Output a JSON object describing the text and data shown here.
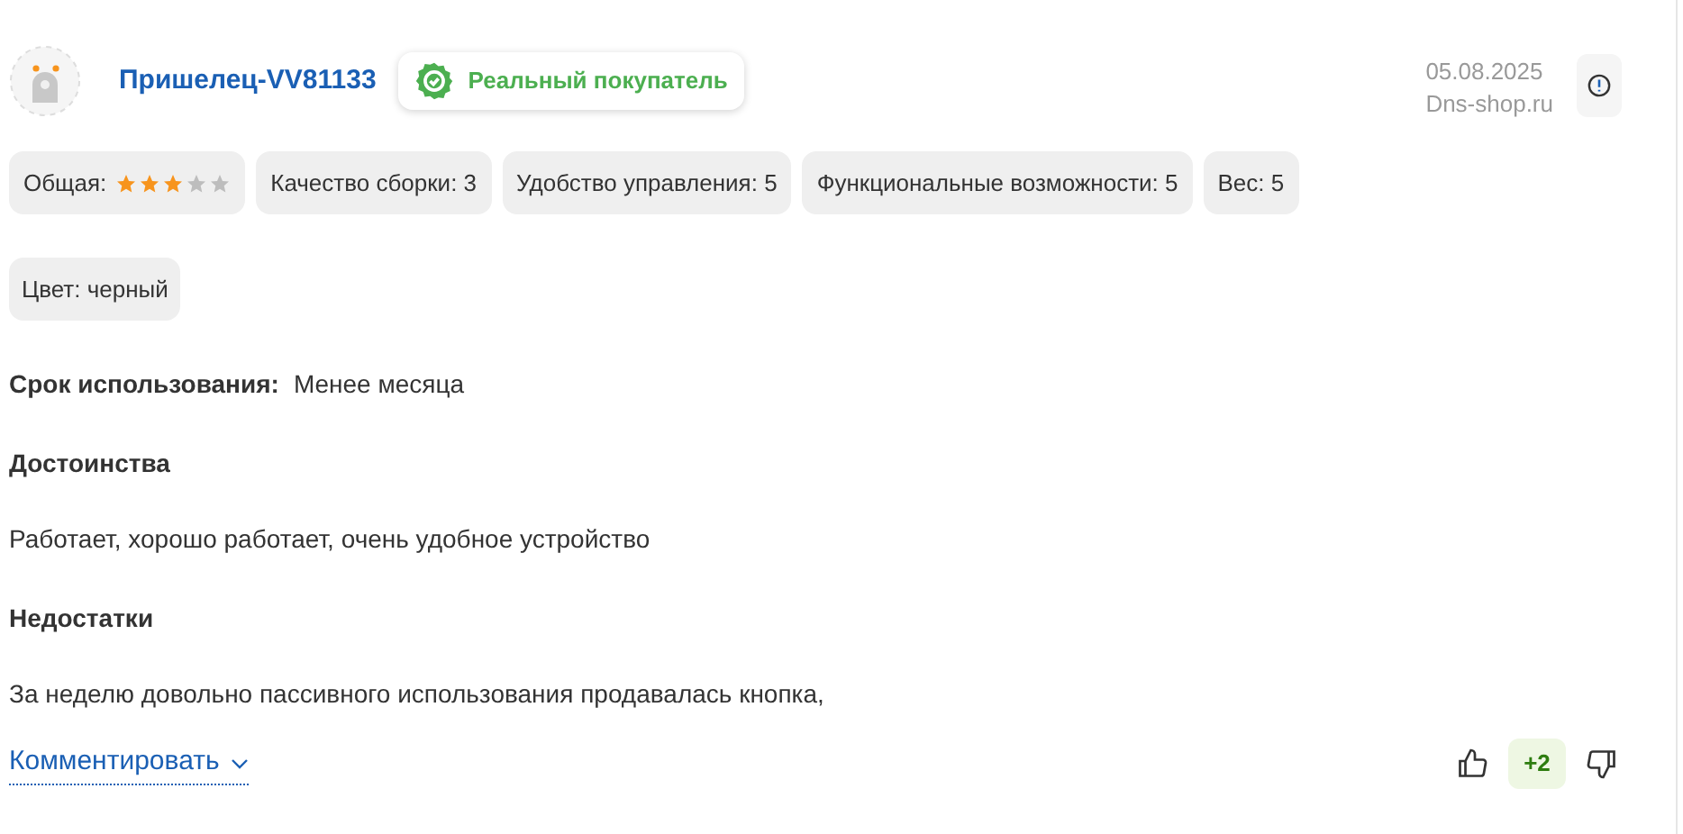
{
  "review": {
    "author": "Пришелец-VV81133",
    "badge": "Реальный покупатель",
    "date": "05.08.2025",
    "source": "Dns-shop.ru",
    "ratings": [
      {
        "kind": "stars",
        "label": "Общая:",
        "stars": 3
      },
      {
        "kind": "text",
        "label": "Качество сборки: 3"
      },
      {
        "kind": "text",
        "label": "Удобство управления: 5"
      },
      {
        "kind": "text",
        "label": "Функциональные возможности: 5"
      },
      {
        "kind": "text",
        "label": "Вес: 5"
      }
    ],
    "tags": [
      "Цвет: черный"
    ],
    "usage": {
      "label": "Срок использования:",
      "value": "Менее месяца"
    },
    "sections": [
      {
        "title": "Достоинства",
        "text": "Работает, хорошо работает, очень удобное устройство"
      },
      {
        "title": "Недостатки",
        "text": "За неделю довольно пассивного использования продавалась кнопка,"
      }
    ],
    "comment_link": "Комментировать",
    "votes": "+2"
  }
}
